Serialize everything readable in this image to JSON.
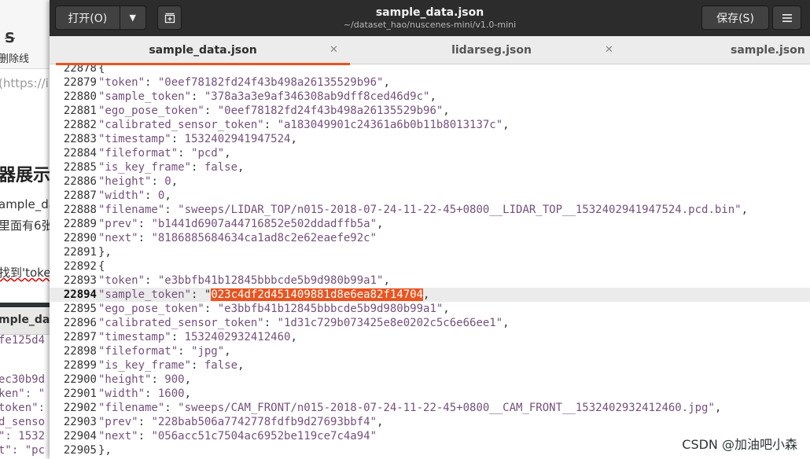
{
  "background": {
    "toolbar_icon": "strikethrough-icon",
    "toolbar_glyph": "S",
    "toolbar_label": "删除线",
    "url_fragment": "(https://i",
    "heading_fragment": "器展示",
    "text_fragment_1": "ample_da",
    "text_fragment_2": "里面有6张",
    "text_fragment_3": "找到'toke",
    "tab_label": "mple_dat",
    "code_fragments": [
      "fe125d4",
      "",
      "ec30b9d",
      "ken\": \"",
      "token\":",
      "d_senso",
      "\": 1532",
      "t\": \"pc"
    ]
  },
  "window": {
    "open_label": "打开(O)",
    "new_tab_icon": "new-tab-icon",
    "save_label": "保存(S)",
    "menu_icon": "hamburger-menu-icon",
    "title": "sample_data.json",
    "subtitle": "~/dataset_hao/nuscenes-mini/v1.0-mini"
  },
  "tabs": [
    {
      "label": "sample_data.json",
      "active": true
    },
    {
      "label": "lidarseg.json",
      "active": false
    },
    {
      "label": "sample.json",
      "active": false
    }
  ],
  "current_line": 22894,
  "highlight_text": "023c4df2d451409881d8e6ea82f14704",
  "lines": [
    {
      "n": "22878",
      "text": "{"
    },
    {
      "n": "22879",
      "text": "\"token\": \"0eef78182fd24f43b498a26135529b96\","
    },
    {
      "n": "22880",
      "text": "\"sample_token\": \"378a3a3e9af346308ab9dff8ced46d9c\","
    },
    {
      "n": "22881",
      "text": "\"ego_pose_token\": \"0eef78182fd24f43b498a26135529b96\","
    },
    {
      "n": "22882",
      "text": "\"calibrated_sensor_token\": \"a183049901c24361a6b0b11b8013137c\","
    },
    {
      "n": "22883",
      "text": "\"timestamp\": 1532402941947524,"
    },
    {
      "n": "22884",
      "text": "\"fileformat\": \"pcd\","
    },
    {
      "n": "22885",
      "text": "\"is_key_frame\": false,"
    },
    {
      "n": "22886",
      "text": "\"height\": 0,"
    },
    {
      "n": "22887",
      "text": "\"width\": 0,"
    },
    {
      "n": "22888",
      "text": "\"filename\": \"sweeps/LIDAR_TOP/n015-2018-07-24-11-22-45+0800__LIDAR_TOP__1532402941947524.pcd.bin\","
    },
    {
      "n": "22889",
      "text": "\"prev\": \"b1441d6907a44716852e502ddadffb5a\","
    },
    {
      "n": "22890",
      "text": "\"next\": \"8186885684634ca1ad8c2e62eaefe92c\""
    },
    {
      "n": "22891",
      "text": "},"
    },
    {
      "n": "22892",
      "text": "{"
    },
    {
      "n": "22893",
      "text": "\"token\": \"e3bbfb41b12845bbbcde5b9d980b99a1\","
    },
    {
      "n": "22894",
      "pre": "\"sample_token\": \"",
      "hl": "023c4df2d451409881d8e6ea82f14704",
      "post": "\","
    },
    {
      "n": "22895",
      "text": "\"ego_pose_token\": \"e3bbfb41b12845bbbcde5b9d980b99a1\","
    },
    {
      "n": "22896",
      "text": "\"calibrated_sensor_token\": \"1d31c729b073425e8e0202c5c6e66ee1\","
    },
    {
      "n": "22897",
      "text": "\"timestamp\": 1532402932412460,"
    },
    {
      "n": "22898",
      "text": "\"fileformat\": \"jpg\","
    },
    {
      "n": "22899",
      "text": "\"is_key_frame\": false,"
    },
    {
      "n": "22900",
      "text": "\"height\": 900,"
    },
    {
      "n": "22901",
      "text": "\"width\": 1600,"
    },
    {
      "n": "22902",
      "text": "\"filename\": \"sweeps/CAM_FRONT/n015-2018-07-24-11-22-45+0800__CAM_FRONT__1532402932412460.jpg\","
    },
    {
      "n": "22903",
      "text": "\"prev\": \"228bab506a7742778fdfb9d27693bbf4\","
    },
    {
      "n": "22904",
      "text": "\"next\": \"056acc51c7504ac6952be119ce7c4a94\""
    },
    {
      "n": "22905",
      "text": "},"
    }
  ],
  "watermark": "CSDN @加油吧小森",
  "colors": {
    "accent": "#e95420",
    "header_bg": "#2c2c2c",
    "string": "#75507b"
  }
}
